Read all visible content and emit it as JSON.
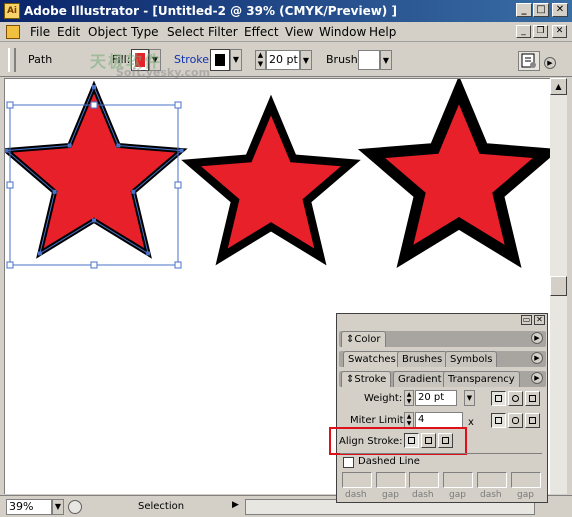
{
  "window": {
    "title": "Adobe Illustrator - [Untitled-2 @ 39% (CMYK/Preview) ]",
    "app_icon_label": "Ai",
    "buttons": {
      "minimize": "_",
      "maximize": "□",
      "close": "✕"
    }
  },
  "menubar": {
    "items": [
      {
        "label": "File"
      },
      {
        "label": "Edit"
      },
      {
        "label": "Object"
      },
      {
        "label": "Type"
      },
      {
        "label": "Select"
      },
      {
        "label": "Filter"
      },
      {
        "label": "Effect"
      },
      {
        "label": "View"
      },
      {
        "label": "Window"
      },
      {
        "label": "Help"
      }
    ],
    "doc_buttons": {
      "minimize": "_",
      "restore": "❐",
      "close": "✕"
    }
  },
  "control_palette": {
    "selection_type": "Path",
    "fill_label": "Fill:",
    "fill_color": "#e8202a",
    "stroke_label": "Stroke:",
    "stroke_color": "#000000",
    "stroke_weight": "20 pt",
    "brush_label": "Brush:",
    "watermark_cn": "天极软件",
    "watermark_en": "Soft.yesky.com"
  },
  "canvas": {
    "shape_fill": "#e8202a",
    "shape_stroke": "#000000",
    "selection_color": "#4a72c8"
  },
  "status_bar": {
    "zoom": "39%",
    "status": "Selection"
  },
  "panel": {
    "color_tab": "Color",
    "tabs_row2": [
      "Swatches",
      "Brushes",
      "Symbols"
    ],
    "tabs_row3": [
      "Stroke",
      "Gradient",
      "Transparency"
    ],
    "weight_label": "Weight:",
    "weight_value": "20 pt",
    "miter_label": "Miter Limit:",
    "miter_value": "4",
    "miter_unit": "x",
    "align_label": "Align Stroke:",
    "dashed_label": "Dashed Line",
    "dashed_checked": false,
    "dash_labels": [
      "dash",
      "gap",
      "dash",
      "gap",
      "dash",
      "gap"
    ],
    "highlight_color": "#e0101b"
  }
}
